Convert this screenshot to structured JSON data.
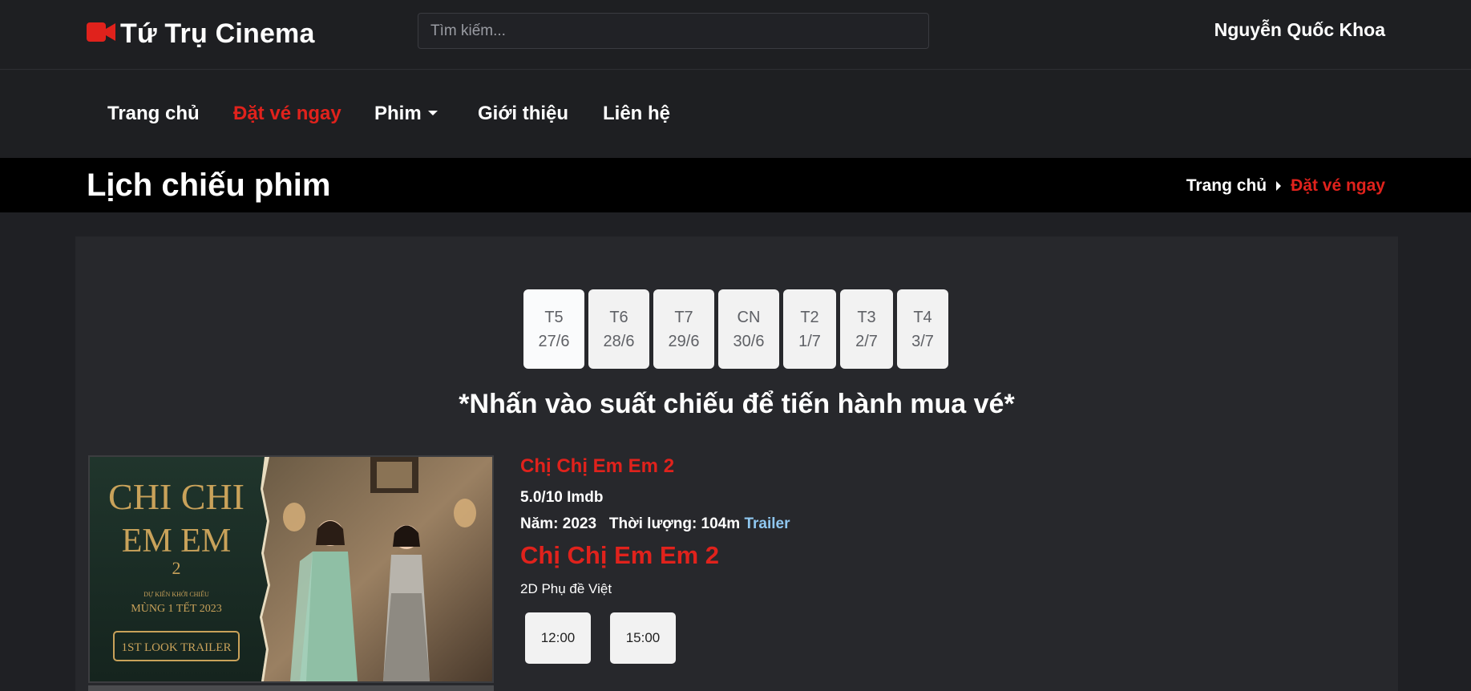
{
  "header": {
    "brand": "Tứ Trụ Cinema",
    "brand_icon": "video-camera-icon",
    "search_placeholder": "Tìm kiếm...",
    "user_name": "Nguyễn Quốc Khoa"
  },
  "nav": {
    "items": [
      {
        "label": "Trang chủ"
      },
      {
        "label": "Đặt vé ngay",
        "active": true
      },
      {
        "label": "Phim",
        "dropdown": true
      },
      {
        "label": "Giới thiệu"
      },
      {
        "label": "Liên hệ"
      }
    ]
  },
  "page": {
    "title": "Lịch chiếu phim",
    "breadcrumb": [
      "Trang chủ",
      "Đặt vé ngay"
    ]
  },
  "dates": [
    {
      "day": "T5",
      "date": "27/6",
      "selected": true
    },
    {
      "day": "T6",
      "date": "28/6"
    },
    {
      "day": "T7",
      "date": "29/6"
    },
    {
      "day": "CN",
      "date": "30/6"
    },
    {
      "day": "T2",
      "date": "1/7"
    },
    {
      "day": "T3",
      "date": "2/7"
    },
    {
      "day": "T4",
      "date": "3/7"
    }
  ],
  "hint": "*Nhấn vào suất chiếu để tiến hành mua vé*",
  "movie": {
    "title": "Chị Chị Em Em 2",
    "rating": "5.0/10 Imdb",
    "year_label": "Năm: 2023",
    "duration_label": "Thời lượng: 104m",
    "trailer_label": "Trailer",
    "subtitle_title": "Chị Chị Em Em 2",
    "format": "2D Phụ đề Việt",
    "showtimes": [
      "12:00",
      "15:00"
    ],
    "poster": {
      "line1": "CHI CHI",
      "line2": "EM EM",
      "number": "2",
      "sub1": "DỰ KIẾN KHỞI CHIẾU",
      "sub2": "MÙNG 1 TẾT 2023",
      "badge": "1ST LOOK TRAILER"
    }
  },
  "colors": {
    "accent": "#e0221c",
    "background": "#1f2024",
    "panel": "#27282c",
    "link": "#8fc7f0"
  }
}
